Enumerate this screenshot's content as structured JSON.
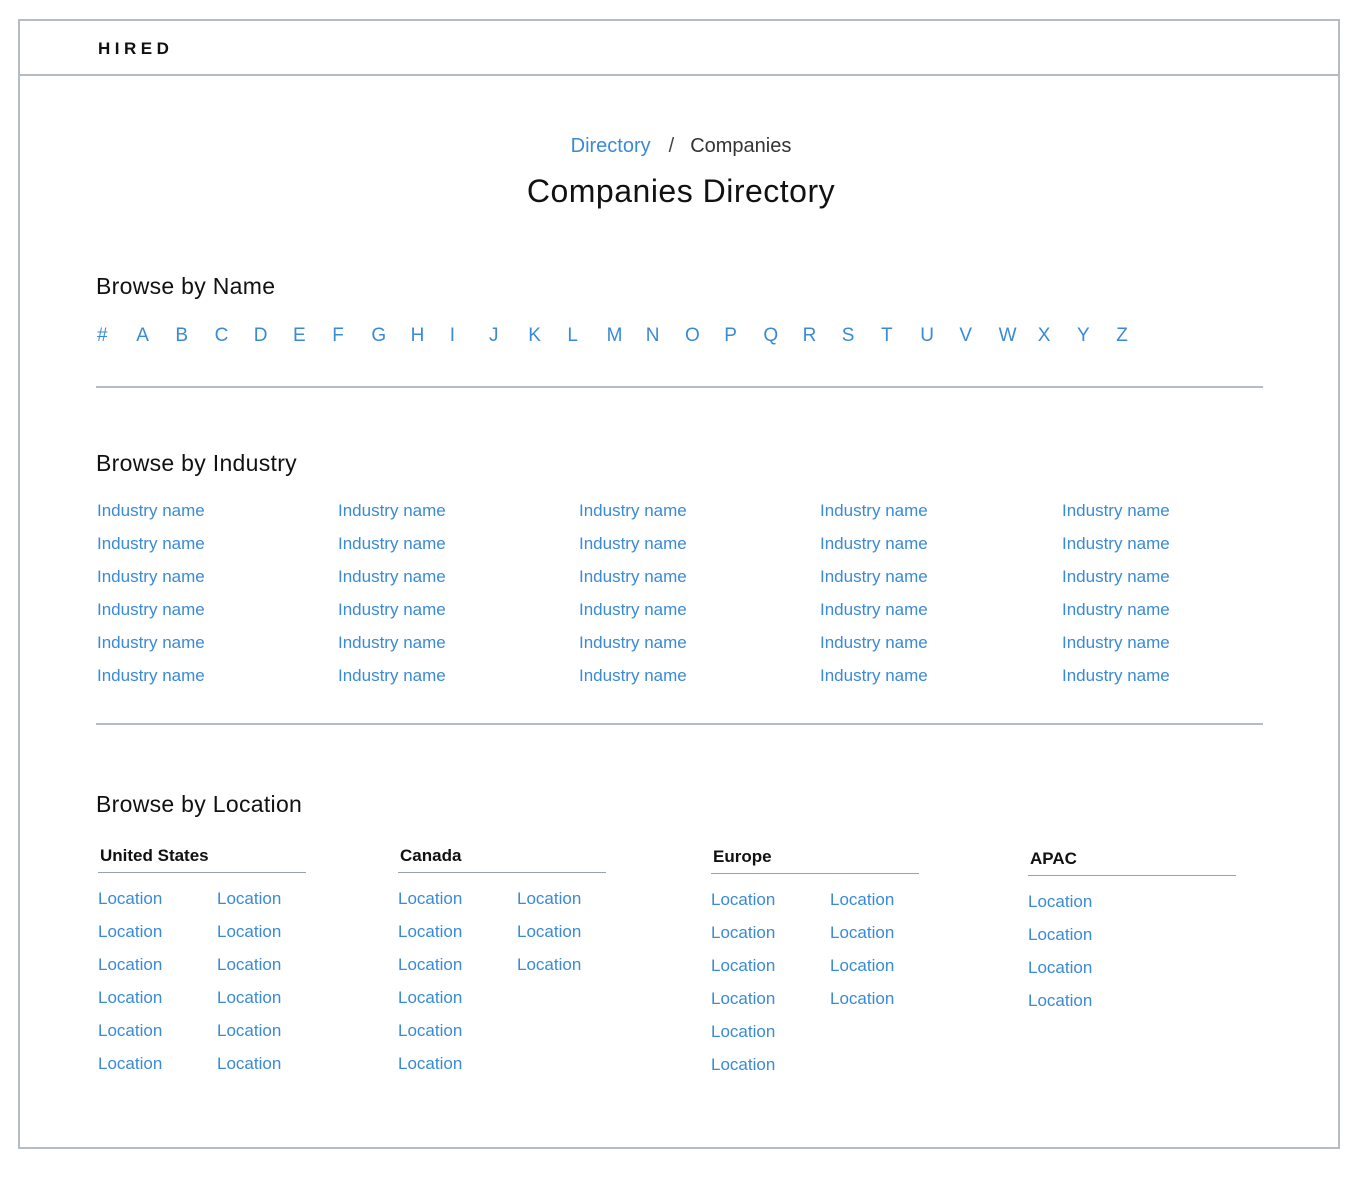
{
  "header": {
    "logo": "HIRED"
  },
  "breadcrumb": {
    "parent": "Directory",
    "separator": "/",
    "current": "Companies"
  },
  "page_title": "Companies Directory",
  "browse_by_name": {
    "heading": "Browse by Name",
    "letters": [
      "#",
      "A",
      "B",
      "C",
      "D",
      "E",
      "F",
      "G",
      "H",
      "I",
      "J",
      "K",
      "L",
      "M",
      "N",
      "O",
      "P",
      "Q",
      "R",
      "S",
      "T",
      "U",
      "V",
      "W",
      "X",
      "Y",
      "Z"
    ]
  },
  "browse_by_industry": {
    "heading": "Browse by Industry",
    "columns": [
      [
        "Industry name",
        "Industry name",
        "Industry name",
        "Industry name",
        "Industry name",
        "Industry name"
      ],
      [
        "Industry name",
        "Industry name",
        "Industry name",
        "Industry name",
        "Industry name",
        "Industry name"
      ],
      [
        "Industry name",
        "Industry name",
        "Industry name",
        "Industry name",
        "Industry name",
        "Industry name"
      ],
      [
        "Industry name",
        "Industry name",
        "Industry name",
        "Industry name",
        "Industry name",
        "Industry name"
      ],
      [
        "Industry name",
        "Industry name",
        "Industry name",
        "Industry name",
        "Industry name",
        "Industry name"
      ]
    ]
  },
  "browse_by_location": {
    "heading": "Browse by Location",
    "groups": [
      {
        "title": "United States",
        "columns": [
          [
            "Location",
            "Location",
            "Location",
            "Location",
            "Location",
            "Location"
          ],
          [
            "Location",
            "Location",
            "Location",
            "Location",
            "Location",
            "Location"
          ]
        ]
      },
      {
        "title": "Canada",
        "columns": [
          [
            "Location",
            "Location",
            "Location",
            "Location",
            "Location",
            "Location"
          ],
          [
            "Location",
            "Location",
            "Location"
          ]
        ]
      },
      {
        "title": "Europe",
        "columns": [
          [
            "Location",
            "Location",
            "Location",
            "Location",
            "Location",
            "Location"
          ],
          [
            "Location",
            "Location",
            "Location",
            "Location"
          ]
        ]
      },
      {
        "title": "APAC",
        "columns": [
          [
            "Location",
            "Location",
            "Location",
            "Location"
          ]
        ]
      }
    ]
  },
  "colors": {
    "link": "#3a8ad6",
    "border": "#b4bcc4",
    "text": "#111111"
  }
}
